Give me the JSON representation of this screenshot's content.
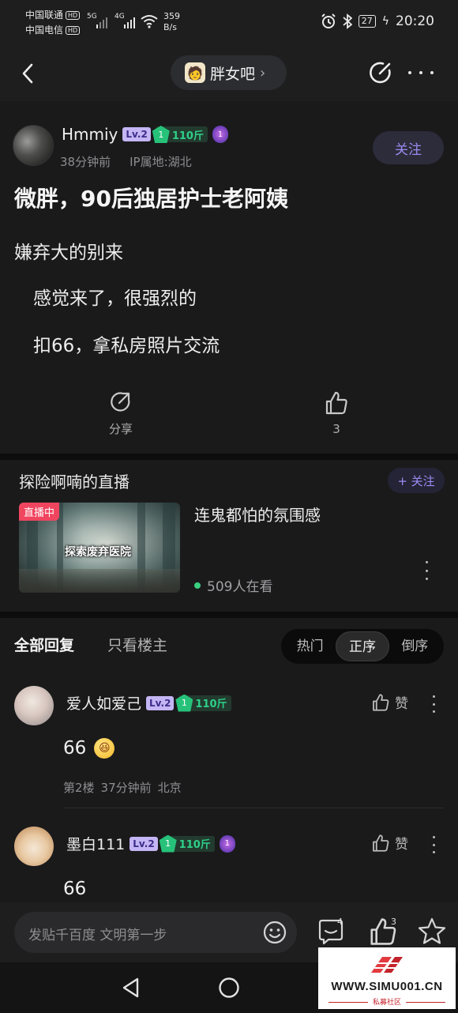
{
  "status": {
    "carrier1": "中国联通",
    "carrier2": "中国电信",
    "hd": "HD",
    "net1": "5G",
    "net2": "4G",
    "speed_value": "359",
    "speed_unit": "B/s",
    "battery": "27",
    "time": "20:20"
  },
  "header": {
    "forum_name": "胖女吧",
    "forum_chevron": "›"
  },
  "post": {
    "author": "Hmmiy",
    "level": "Lv.2",
    "gem_level": "1",
    "weight": "110斤",
    "medal": "1",
    "time_ago": "38分钟前",
    "ip": "IP属地:湖北",
    "follow_label": "关注",
    "title": "微胖，90后独居护士老阿姨",
    "lines": [
      "嫌弃大的别来",
      "感觉来了，很强烈的",
      "扣66，拿私房照片交流"
    ],
    "share_label": "分享",
    "like_count": "3"
  },
  "live": {
    "title": "探险啊喃的直播",
    "follow_label": "+ 关注",
    "badge": "直播中",
    "thumb_caption": "探索废弃医院",
    "description": "连鬼都怕的氛围感",
    "viewers": "509人在看"
  },
  "replies": {
    "tab_all": "全部回复",
    "tab_op": "只看楼主",
    "sort_options": [
      "热门",
      "正序",
      "倒序"
    ],
    "sort_selected": "正序",
    "like_label": "赞",
    "comments": [
      {
        "name": "爱人如爱己",
        "level": "Lv.2",
        "gem_level": "1",
        "weight": "110斤",
        "text": "66",
        "floor": "第2楼",
        "time": "37分钟前",
        "location": "北京"
      },
      {
        "name": "墨白111",
        "level": "Lv.2",
        "gem_level": "1",
        "weight": "110斤",
        "medal": "1",
        "text": "66"
      }
    ]
  },
  "bottom": {
    "input_placeholder": "发贴千百度 文明第一步",
    "comment_count": "4",
    "like_count": "3"
  },
  "watermark": {
    "text": "WWW.SIMU001.CN",
    "sub": "私募社区"
  },
  "colors": {
    "accent_purple": "#9a8cf1",
    "live_red": "#f0455f",
    "weight_green": "#2fd08a"
  }
}
